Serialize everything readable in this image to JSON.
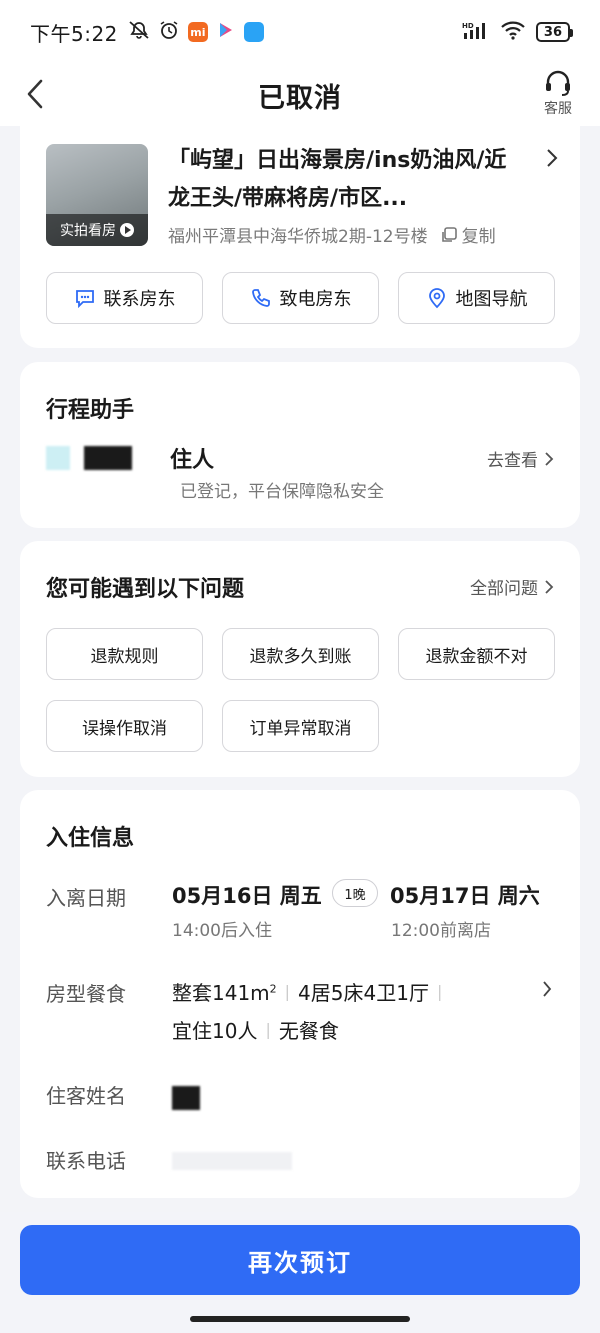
{
  "status_bar": {
    "time": "下午5:22",
    "battery": "36",
    "hd": "HD"
  },
  "nav": {
    "title": "已取消",
    "service_label": "客服"
  },
  "hotel": {
    "name": "「屿望」日出海景房/ins奶油风/近龙王头/带麻将房/市区...",
    "address": "福州平潭县中海华侨城2期-12号楼",
    "copy_label": "复制",
    "thumb_tag": "实拍看房",
    "actions": [
      "联系房东",
      "致电房东",
      "地图导航"
    ]
  },
  "trip_assistant": {
    "title": "行程助手",
    "line1": "住人",
    "line2": "已登记，平台保障隐私安全",
    "link": "去查看"
  },
  "questions": {
    "title": "您可能遇到以下问题",
    "all_link": "全部问题",
    "items": [
      "退款规则",
      "退款多久到账",
      "退款金额不对",
      "误操作取消",
      "订单异常取消"
    ]
  },
  "checkin": {
    "title": "入住信息",
    "date_label": "入离日期",
    "checkin_date": "05月16日 周五",
    "checkin_time": "14:00后入住",
    "nights": "1晚",
    "checkout_date": "05月17日 周六",
    "checkout_time": "12:00前离店",
    "room_label": "房型餐食",
    "room_area": "整套141m",
    "room_area_sup": "2",
    "room_layout": "4居5床4卫1厅",
    "room_capacity": "宜住10人",
    "room_meal": "无餐食",
    "guest_label": "住客姓名",
    "phone_label": "联系电话"
  },
  "footer": {
    "book_again": "再次预订"
  },
  "colors": {
    "primary": "#2f6bf5",
    "background": "#f3f4f8"
  }
}
